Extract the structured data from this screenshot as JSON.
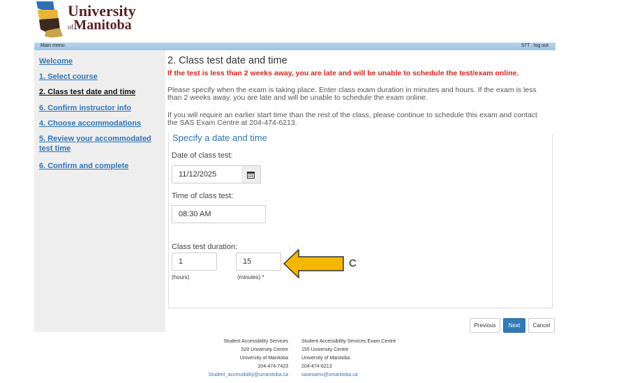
{
  "brand": {
    "name_line1": "University",
    "name_of": "of",
    "name_line2": "Manitoba"
  },
  "menubar": {
    "left": "Main menu",
    "user": "57T",
    "logout": "log out"
  },
  "sidebar": {
    "items": [
      {
        "label": "Welcome",
        "active": false
      },
      {
        "label": "1. Select course",
        "active": false
      },
      {
        "label": "2. Class test date and time",
        "active": true
      },
      {
        "label": "6. Confirm instructor info",
        "active": false
      },
      {
        "label": "4. Choose accommodations",
        "active": false
      },
      {
        "label_line1": "5. Review your accommodated",
        "label_line2": "test time",
        "active": false
      },
      {
        "label": "6. Confirm and complete",
        "active": false
      }
    ]
  },
  "main": {
    "title": "2. Class test date and time",
    "warning": "If the test is less than 2 weeks away, you are late and will be unable to schedule the test/exam online.",
    "para1_line1": "Please specify when the exam is taking place.  Enter class exam duration in minutes and hours. If the exam is less",
    "para1_line2": "than 2 weeks away, you are late and will be unable to schedule the exam online.",
    "para2_line1": "If you will require an earlier start time than the rest of the class, please continue to schedule this exam and contact",
    "para2_line2": "the SAS Exam Centre at 204-474-6213."
  },
  "form": {
    "panel_title": "Specify a date and time",
    "date_label": "Date of class test:",
    "date_value": "11/12/2025",
    "time_label": "Time of class test:",
    "time_value": "08:30 AM",
    "duration_label": "Class test duration:",
    "hours_value": "1",
    "hours_caption": "(hours)",
    "minutes_value": "15",
    "minutes_caption": "(minutes)",
    "required_mark": "*"
  },
  "annotation": {
    "label": "C",
    "arrow_color": "#f5b800"
  },
  "buttons": {
    "previous": "Previous",
    "next": "Next",
    "cancel": "Cancel"
  },
  "footer": {
    "left": [
      "Student Accessibility Services",
      "520 University Centre",
      "University of Manitoba",
      "204-474-7423",
      "Student_accessibility@umanitoba.ca"
    ],
    "right": [
      "Student Accessibility Services Exam Centre",
      "155 University Centre",
      "University of Manitoba",
      "204-474-6213",
      "sasexams@umanitoba.ca"
    ]
  },
  "colors": {
    "link": "#2f74b5",
    "warning": "#d9251c",
    "primary_button": "#337ab7",
    "brand": "#5a1f1f"
  }
}
